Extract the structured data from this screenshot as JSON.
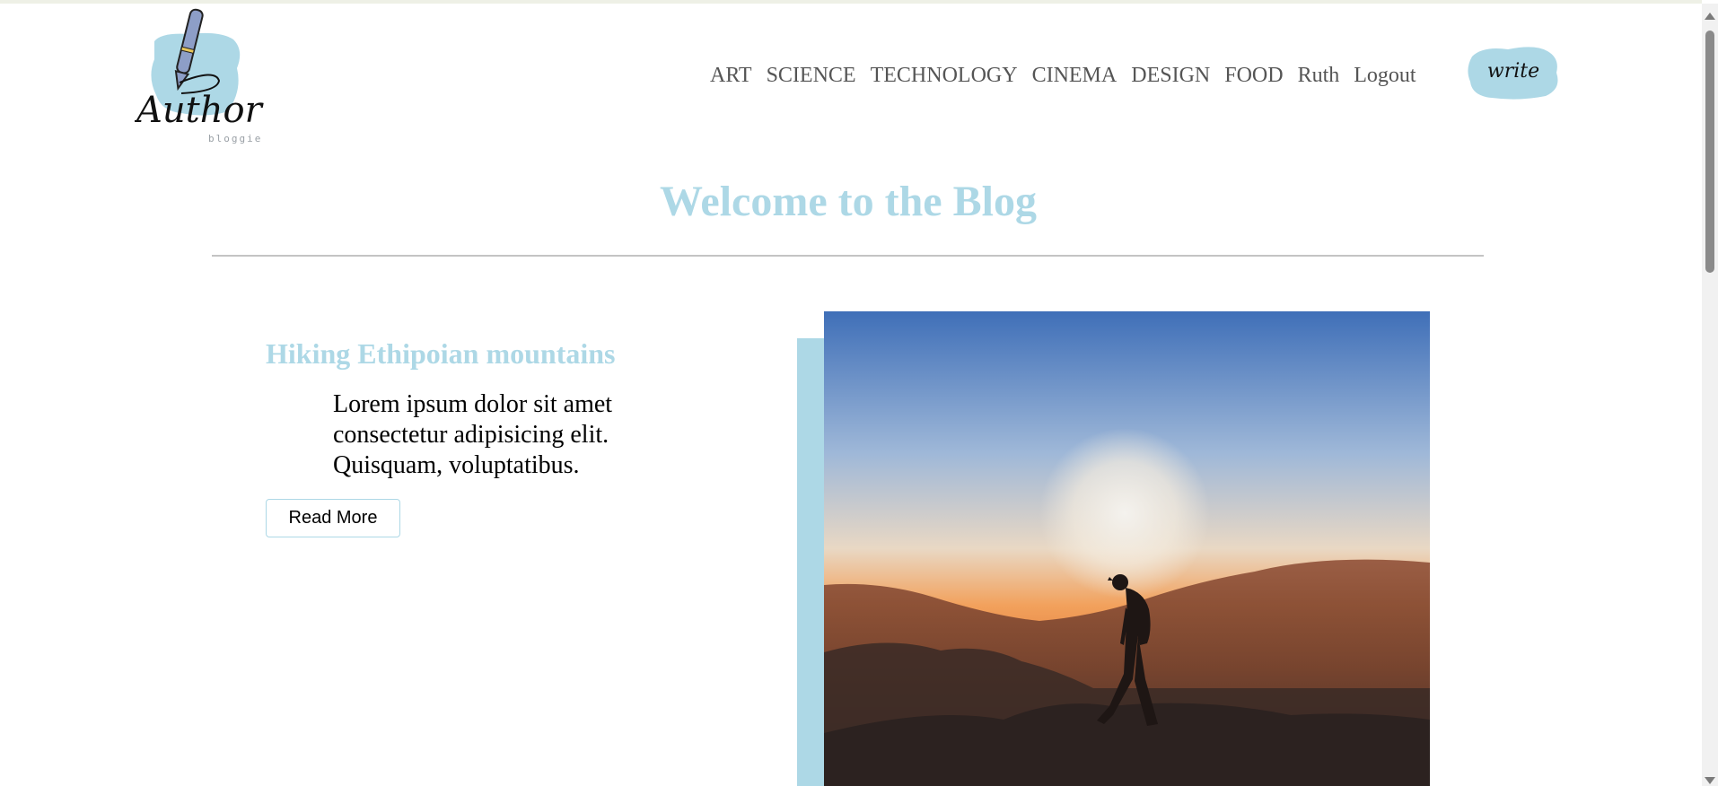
{
  "logo": {
    "main_text": "Author",
    "sub_text": "bloggie"
  },
  "nav": {
    "items": [
      "ART",
      "SCIENCE",
      "TECHNOLOGY",
      "CINEMA",
      "DESIGN",
      "FOOD",
      "Ruth",
      "Logout"
    ],
    "write_label": "write"
  },
  "main": {
    "title": "Welcome to the Blog"
  },
  "post": {
    "title": "Hiking Ethipoian mountains",
    "description": "Lorem ipsum dolor sit amet consectetur adipisicing elit. Quisquam, voluptatibus.",
    "read_more_label": "Read More"
  },
  "colors": {
    "accent": "#add8e6",
    "nav_text": "#555555",
    "divider": "#c4c4c4"
  }
}
